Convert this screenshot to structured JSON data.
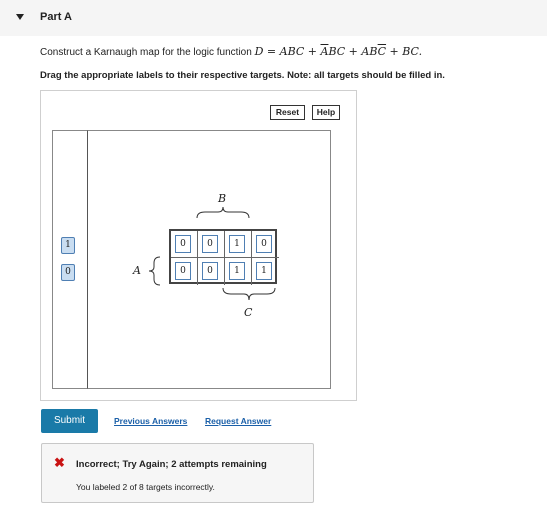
{
  "part": {
    "title": "Part A"
  },
  "instructions": {
    "lead": "Construct a Karnaugh map for the logic function ",
    "expr": {
      "lhs": "D",
      "eq": " = ",
      "t1": "ABC",
      "plus1": " + ",
      "t2_bar": "A",
      "t2_rest": "BC",
      "plus2": " + ",
      "t3_head": "AB",
      "t3_bar": "C",
      "plus3": " + ",
      "t4": "BC",
      "end": "."
    },
    "drag_text": "Drag the appropriate labels to their respective targets. Note: all targets should be filled in."
  },
  "toolbar": {
    "reset_label": "Reset",
    "help_label": "Help"
  },
  "palette": {
    "labels": [
      "1",
      "0"
    ]
  },
  "kmap": {
    "var_b": "B",
    "var_a": "A",
    "var_c": "C",
    "rows": [
      [
        "0",
        "0",
        "1",
        "0"
      ],
      [
        "0",
        "0",
        "1",
        "1"
      ]
    ]
  },
  "actions": {
    "submit_label": "Submit",
    "previous_answers": "Previous Answers",
    "request_answer": "Request Answer"
  },
  "feedback": {
    "message": "Incorrect; Try Again; 2 attempts remaining",
    "detail": "You labeled 2 of 8 targets incorrectly."
  },
  "colors": {
    "submit_bg": "#1a7aa8",
    "link": "#1a5fa8",
    "error": "#c91313",
    "label_fill": "#c9ddf1",
    "label_border": "#4f7fb3"
  }
}
